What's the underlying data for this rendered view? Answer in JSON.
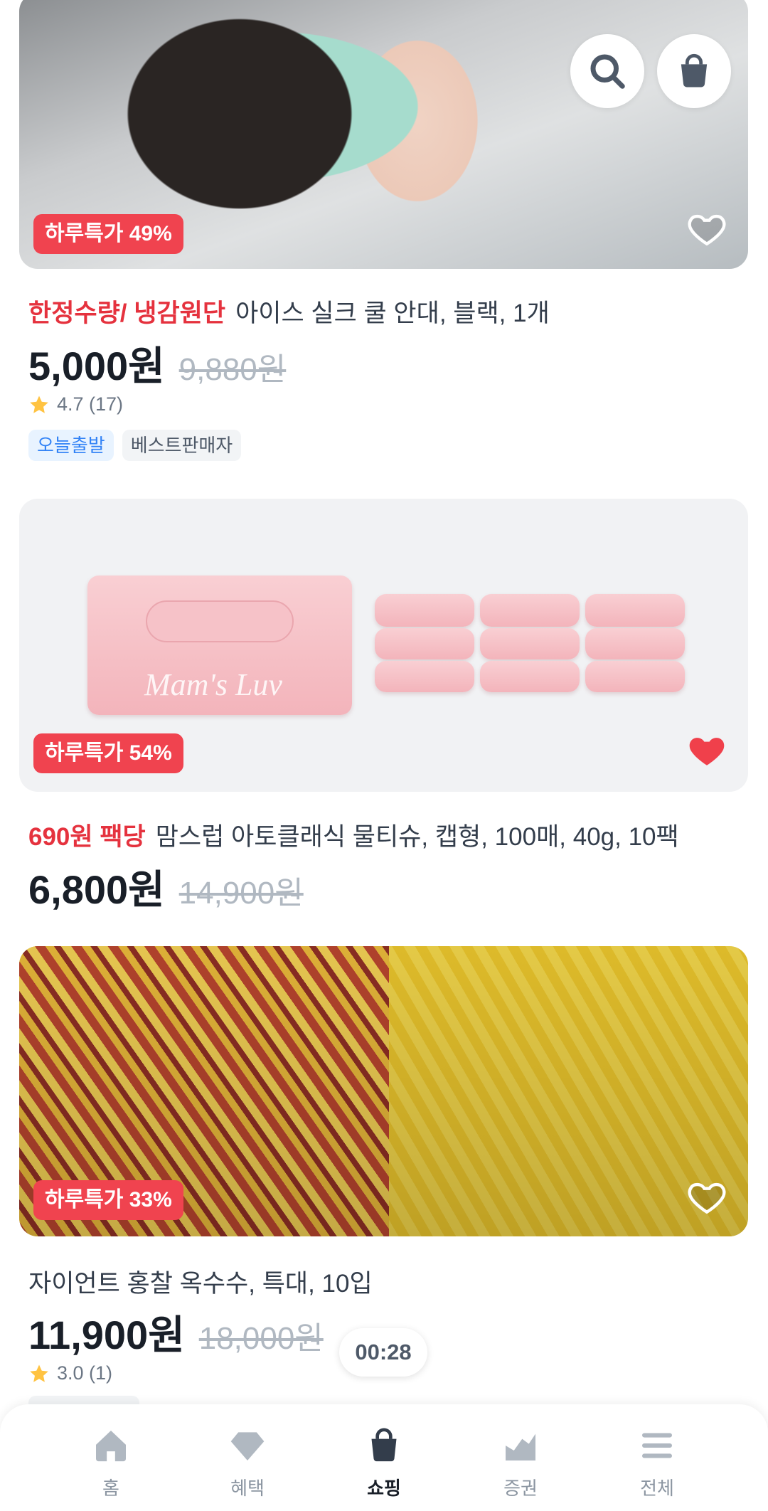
{
  "header": {
    "search_icon": "search-icon",
    "cart_icon": "shopping-bag-icon"
  },
  "products": [
    {
      "badge": "하루특가 49%",
      "highlight": "한정수량/ 냉감원단",
      "name": "아이스 실크 쿨 안대, 블랙, 1개",
      "price": "5,000원",
      "original_price": "9,880원",
      "rating": "4.7 (17)",
      "tags": [
        "오늘출발",
        "베스트판매자"
      ],
      "liked": false
    },
    {
      "badge": "하루특가 54%",
      "highlight": "690원 팩당",
      "name": "맘스럽 아토클래식 물티슈, 캡형, 100매, 40g, 10팩",
      "price": "6,800원",
      "original_price": "14,900원",
      "liked": true,
      "pack_text": "Mam's Luv"
    },
    {
      "badge": "하루특가 33%",
      "highlight": "",
      "name": "자이언트 홍찰 옥수수, 특대, 10입",
      "price": "11,900원",
      "original_price": "18,000원",
      "rating": "3.0 (1)",
      "liked": false
    }
  ],
  "timer": "00:28",
  "tabbar": [
    {
      "label": "홈",
      "icon": "home-icon",
      "active": false
    },
    {
      "label": "혜택",
      "icon": "diamond-icon",
      "active": false
    },
    {
      "label": "쇼핑",
      "icon": "shopping-bag-icon",
      "active": true
    },
    {
      "label": "증권",
      "icon": "chart-icon",
      "active": false
    },
    {
      "label": "전체",
      "icon": "menu-icon",
      "active": false
    }
  ],
  "colors": {
    "accent_red": "#f0434f",
    "highlight_red": "#e5323e",
    "heart_red": "#f0404b",
    "tag_blue": "#3182f6"
  }
}
